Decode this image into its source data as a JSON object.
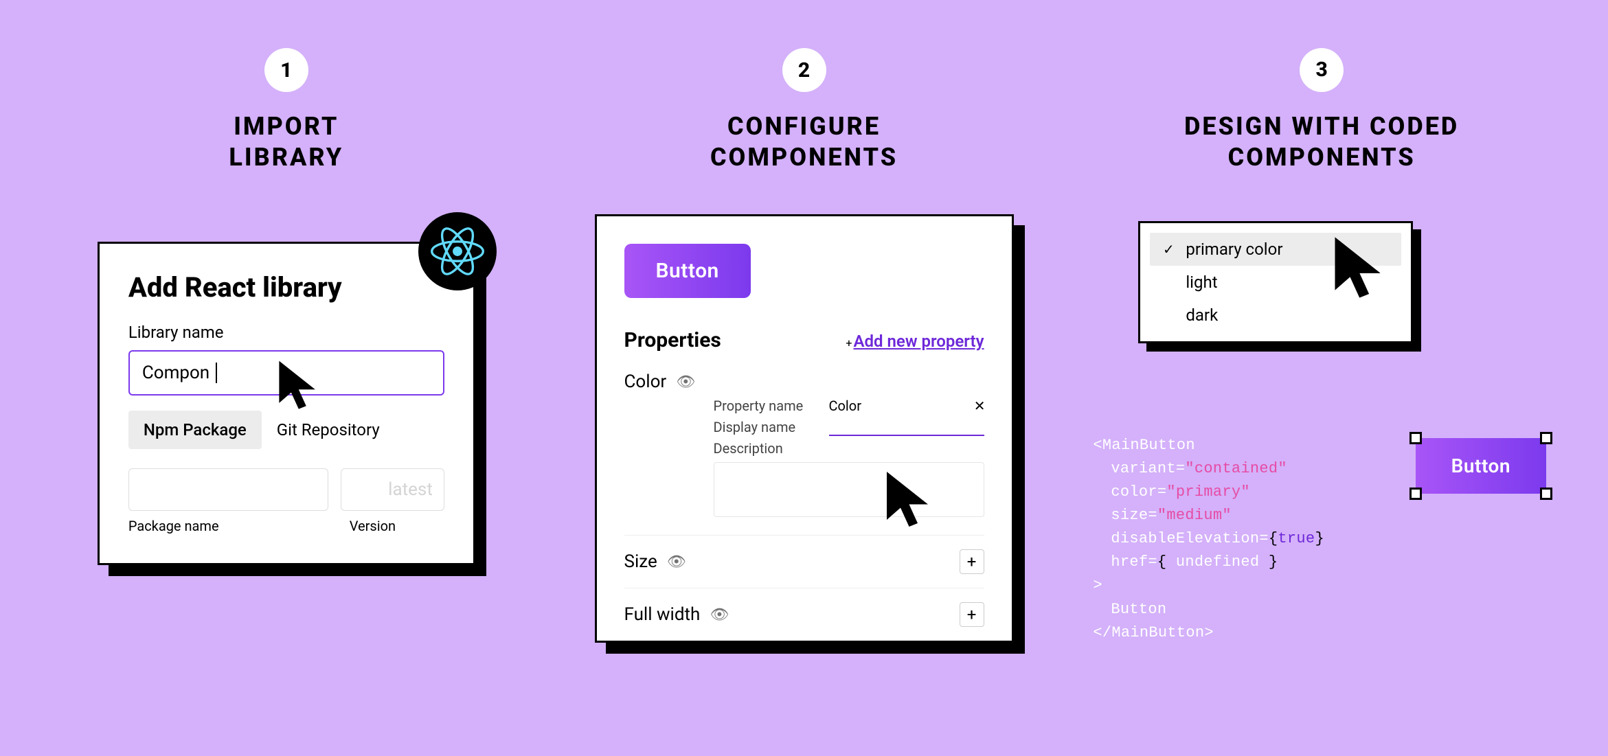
{
  "steps": {
    "s1": {
      "num": "1",
      "title": "IMPORT\nLIBRARY"
    },
    "s2": {
      "num": "2",
      "title": "CONFIGURE\nCOMPONENTS"
    },
    "s3": {
      "num": "3",
      "title": "DESIGN WITH CODED\nCOMPONENTS"
    }
  },
  "import": {
    "heading": "Add React library",
    "libname_label": "Library name",
    "libname_value": "Compon",
    "tabs": {
      "npm": "Npm Package",
      "git": "Git Repository"
    },
    "version_placeholder": "latest",
    "pkg_label": "Package name",
    "ver_label": "Version"
  },
  "configure": {
    "button_label": "Button",
    "properties_heading": "Properties",
    "add_link": "Add new property",
    "color": {
      "name": "Color",
      "pn_label": "Property name",
      "pn_value": "Color",
      "dn_label": "Display name",
      "desc_label": "Description"
    },
    "size_label": "Size",
    "fullwidth_label": "Full width"
  },
  "design": {
    "dropdown": {
      "options": [
        "primary color",
        "light",
        "dark"
      ],
      "selected_index": 0
    },
    "code": {
      "open_tag": "<MainButton",
      "attrs": [
        {
          "k": "variant",
          "v": "\"contained\"",
          "type": "str"
        },
        {
          "k": "color",
          "v": "\"primary\"",
          "type": "str"
        },
        {
          "k": "size",
          "v": "\"medium\"",
          "type": "str"
        },
        {
          "k": "disableElevation",
          "v": "true",
          "type": "bool",
          "braced": true
        },
        {
          "k": "href",
          "v": "undefined",
          "type": "und",
          "braced": true,
          "spaced": true
        }
      ],
      "close_open": ">",
      "body": "Button",
      "close_tag": "</MainButton>"
    },
    "design_button_label": "Button"
  }
}
